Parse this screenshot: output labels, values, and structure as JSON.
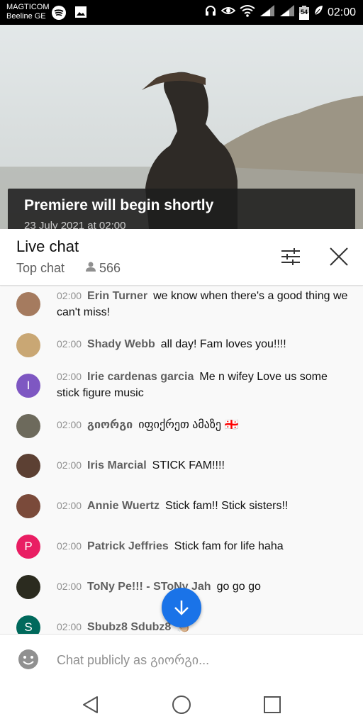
{
  "status_bar": {
    "carrier_line1": "MAGTICOM",
    "carrier_line2": "Beeline GE",
    "battery": "54",
    "time": "02:00",
    "icons": [
      "spotify-icon",
      "image-icon",
      "headphones-icon",
      "eye-icon",
      "wifi-icon",
      "signal-icon",
      "battery-icon",
      "leaf-icon"
    ]
  },
  "video": {
    "title": "Premiere will begin shortly",
    "subtitle": "23 July 2021 at 02:00"
  },
  "chat_header": {
    "title": "Live chat",
    "mode": "Top chat",
    "viewers": "566"
  },
  "messages": [
    {
      "time": "02:00",
      "author": "Erin Turner",
      "text": "we know when there's a good thing we can't miss!",
      "avatar_color": "#a57b5f",
      "avatar_letter": ""
    },
    {
      "time": "02:00",
      "author": "Shady Webb",
      "text": "all day! Fam loves you!!!!",
      "avatar_color": "#c9a774",
      "avatar_letter": ""
    },
    {
      "time": "02:00",
      "author": "Irie cardenas garcia",
      "text": "Me n wifey Love us some stick figure music",
      "avatar_color": "#7e57c2",
      "avatar_letter": "I"
    },
    {
      "time": "02:00",
      "author": "გიორგი",
      "text": "იფიქრეთ ამაზე 🇬🇪",
      "avatar_color": "#6d6a5c",
      "avatar_letter": ""
    },
    {
      "time": "02:00",
      "author": "Iris Marcial",
      "text": "STICK FAM!!!!",
      "avatar_color": "#5c4033",
      "avatar_letter": ""
    },
    {
      "time": "02:00",
      "author": "Annie Wuertz",
      "text": "Stick fam!! Stick sisters!!",
      "avatar_color": "#7a4a3a",
      "avatar_letter": ""
    },
    {
      "time": "02:00",
      "author": "Patrick Jeffries",
      "text": "Stick fam for life haha",
      "avatar_color": "#e91e63",
      "avatar_letter": "P"
    },
    {
      "time": "02:00",
      "author": "ToNy Pe!!! - SToNy Jah",
      "text": "go go go",
      "avatar_color": "#2b2b1f",
      "avatar_letter": ""
    },
    {
      "time": "02:00",
      "author": "Sbubz8 Sdubz8",
      "text": "👏🏼",
      "avatar_color": "#00695c",
      "avatar_letter": "S"
    }
  ],
  "input": {
    "placeholder": "Chat publicly as გიორგი..."
  },
  "nav": {
    "buttons": [
      "back-icon",
      "home-icon",
      "recents-icon"
    ]
  }
}
